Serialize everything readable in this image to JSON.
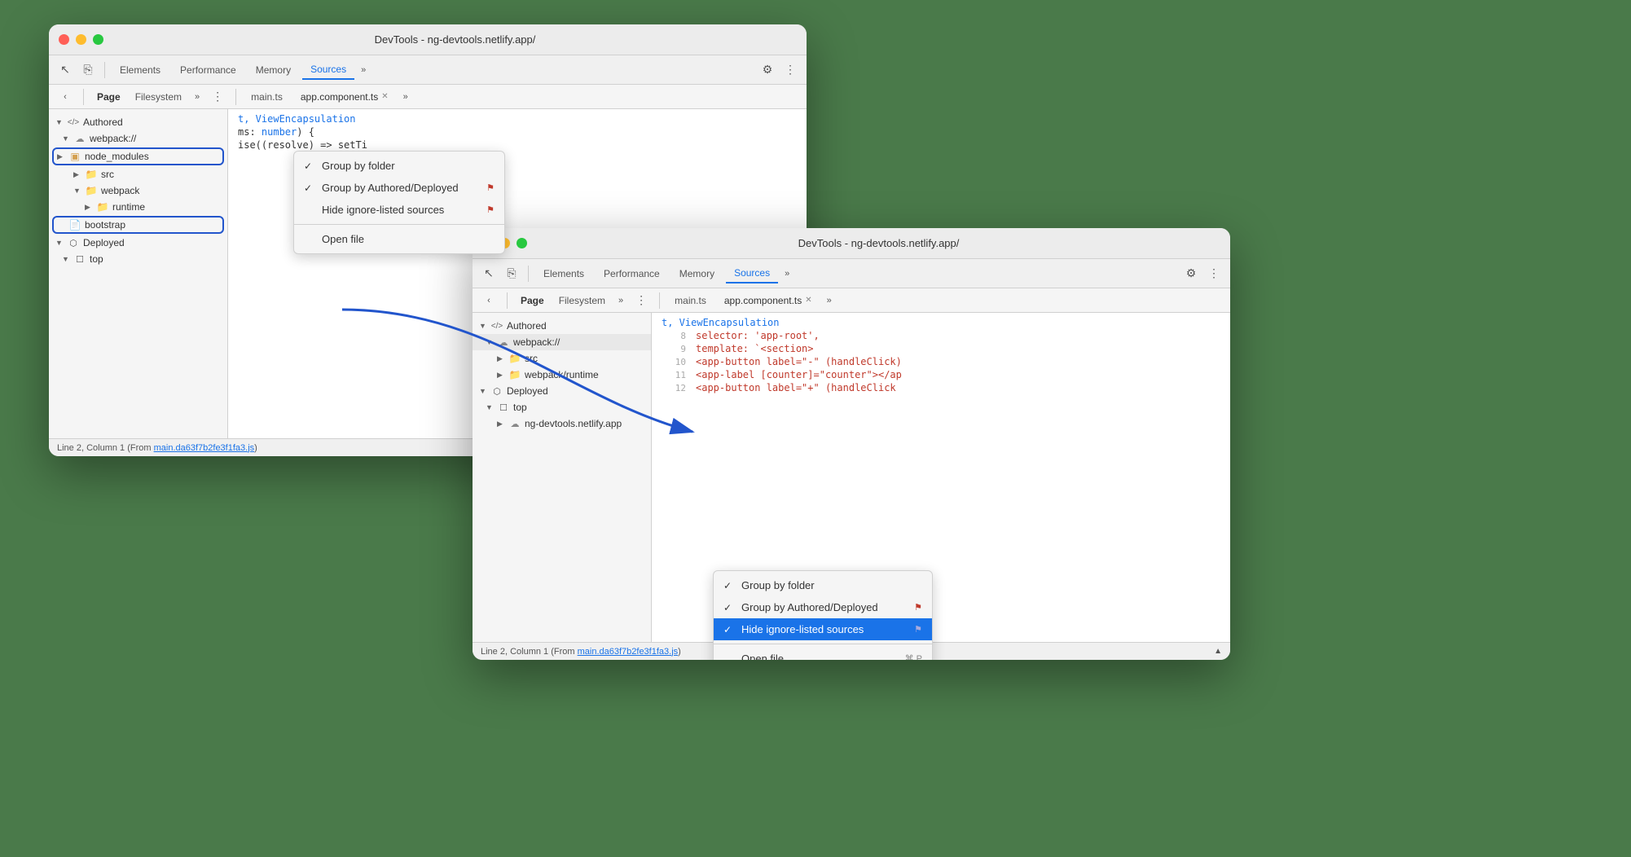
{
  "window_back": {
    "title": "DevTools - ng-devtools.netlify.app/",
    "tabs": [
      "Elements",
      "Performance",
      "Memory",
      "Sources"
    ],
    "active_tab": "Sources",
    "secondary_tabs": [
      "Page",
      "Filesystem"
    ],
    "open_files": [
      "main.ts",
      "app.component.ts"
    ],
    "tree": {
      "authored": {
        "label": "</> Authored",
        "children": {
          "webpack": {
            "label": "webpack://",
            "children": {
              "node_modules": {
                "label": "node_modules",
                "outlined": true
              },
              "src": {
                "label": "src"
              },
              "webpack": {
                "label": "webpack",
                "children": {
                  "runtime": {
                    "label": "runtime"
                  }
                }
              },
              "bootstrap": {
                "label": "bootstrap",
                "outlined": true
              }
            }
          }
        }
      },
      "deployed": {
        "label": "Deployed",
        "children": {
          "top": {
            "label": "top"
          }
        }
      }
    },
    "context_menu": {
      "items": [
        {
          "check": true,
          "label": "Group by folder",
          "warn": false,
          "shortcut": ""
        },
        {
          "check": true,
          "label": "Group by Authored/Deployed",
          "warn": true,
          "shortcut": ""
        },
        {
          "check": false,
          "label": "Hide ignore-listed sources",
          "warn": true,
          "shortcut": ""
        },
        {
          "divider": true
        },
        {
          "check": false,
          "label": "Open file",
          "warn": false,
          "shortcut": ""
        }
      ]
    },
    "code": {
      "partial": "t, ViewEncapsulation",
      "lines": [
        {
          "num": "",
          "content": "t, ViewEncapsulation"
        },
        {
          "num": "",
          "content": "ms: number) {"
        },
        {
          "num": "",
          "content": "ise((resolve) => setTi"
        }
      ]
    },
    "status": "Line 2, Column 1 (From",
    "status_link": "main.da63f7b2fe3f1fa3.js",
    "status_icon": "▲"
  },
  "window_front": {
    "title": "DevTools - ng-devtools.netlify.app/",
    "tabs": [
      "Elements",
      "Performance",
      "Memory",
      "Sources"
    ],
    "active_tab": "Sources",
    "secondary_tabs": [
      "Page",
      "Filesystem"
    ],
    "open_files": [
      "main.ts",
      "app.component.ts"
    ],
    "tree": {
      "authored": {
        "label": "</> Authored",
        "children": {
          "webpack": {
            "label": "webpack://",
            "children": {
              "src": {
                "label": "src"
              },
              "webpack_runtime": {
                "label": "webpack/runtime"
              }
            }
          }
        }
      },
      "deployed": {
        "label": "Deployed",
        "children": {
          "top": {
            "label": "top",
            "children": {
              "ng_devtools": {
                "label": "ng-devtools.netlify.app"
              }
            }
          }
        }
      }
    },
    "context_menu": {
      "items": [
        {
          "check": true,
          "label": "Group by folder",
          "warn": false,
          "shortcut": ""
        },
        {
          "check": true,
          "label": "Group by Authored/Deployed",
          "warn": true,
          "shortcut": ""
        },
        {
          "check": true,
          "label": "Hide ignore-listed sources",
          "warn": true,
          "shortcut": "",
          "selected": true
        },
        {
          "divider": true
        },
        {
          "check": false,
          "label": "Open file",
          "warn": false,
          "shortcut": "⌘ P"
        }
      ]
    },
    "code": {
      "lines": [
        {
          "num": "",
          "content": "t, ViewEncapsulation"
        },
        {
          "num": "8",
          "content": "selector: 'app-root',"
        },
        {
          "num": "9",
          "content": "template: `<section>"
        },
        {
          "num": "10",
          "content": "<app-button label=\"-\" (handleClick)"
        },
        {
          "num": "11",
          "content": "<app-label [counter]=\"counter\"></ap"
        },
        {
          "num": "12",
          "content": "<app-button label=\"+\" (handleClick"
        }
      ]
    },
    "status": "Line 2, Column 1 (From",
    "status_link": "main.da63f7b2fe3f1fa3.js",
    "status_icon": "▲"
  },
  "icons": {
    "close": "●",
    "minimize": "●",
    "maximize": "●",
    "arrow_back": "‹",
    "copy": "⎘",
    "gear": "⚙",
    "more": "⋮",
    "more_horiz": "»",
    "check": "✓",
    "folder": "📁",
    "file": "📄",
    "cloud": "☁",
    "box": "⬡",
    "square": "☐",
    "code_tag": "</>",
    "triangle_right": "▶",
    "triangle_down": "▼"
  }
}
